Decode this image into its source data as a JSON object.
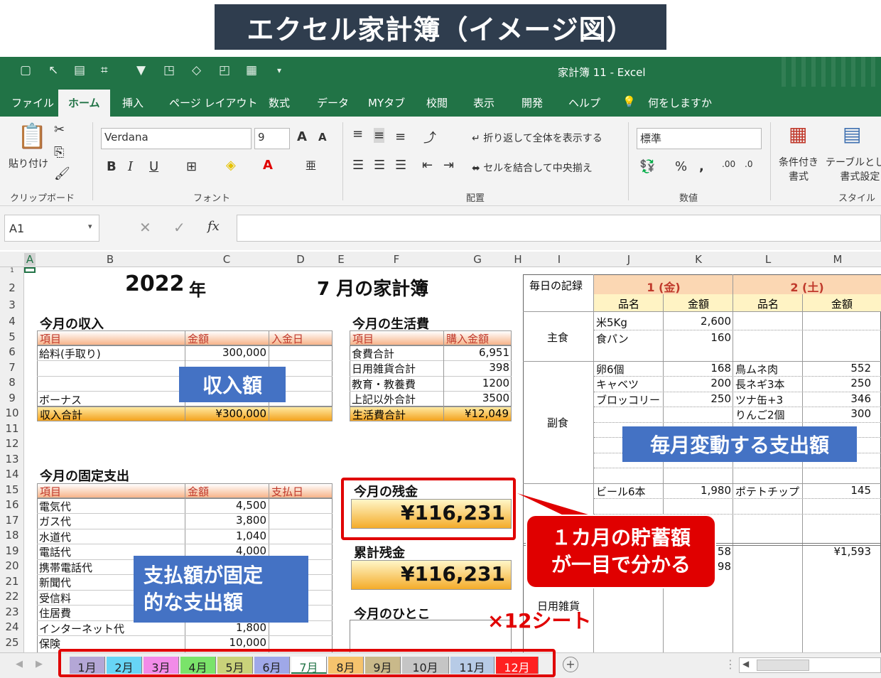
{
  "banner": {
    "title": "エクセル家計簿（イメージ図）"
  },
  "window": {
    "title": "家計簿 11  -  Excel"
  },
  "ribbon_tabs": [
    "ファイル",
    "ホーム",
    "挿入",
    "ページ レイアウト",
    "数式",
    "データ",
    "MYタブ",
    "校閲",
    "表示",
    "開発",
    "ヘルプ"
  ],
  "tell_me": "何をしますか",
  "ribbon": {
    "paste": "貼り付け",
    "clipboard_group": "クリップボード",
    "font_name": "Verdana",
    "font_size": "9",
    "font_group": "フォント",
    "wrap_text": "折り返して全体を表示する",
    "merge_center": "セルを結合して中央揃え",
    "align_group": "配置",
    "number_format": "標準",
    "number_group": "数値",
    "cond_format": "条件付き\n書式",
    "table_format": "テーブルとして\n書式設定",
    "style_group": "スタイル"
  },
  "namebox": "A1",
  "fx": "fx",
  "columns": [
    "A",
    "B",
    "C",
    "D",
    "E",
    "F",
    "G",
    "H",
    "I",
    "J",
    "K",
    "L",
    "M"
  ],
  "rows": [
    "1",
    "2",
    "3",
    "4",
    "5",
    "6",
    "7",
    "8",
    "9",
    "10",
    "11",
    "12",
    "13",
    "14",
    "15",
    "16",
    "17",
    "18",
    "19",
    "20",
    "21",
    "22",
    "23",
    "24",
    "25"
  ],
  "sheet": {
    "year": "2022",
    "year_unit": "年",
    "month_title": "7 月の家計簿",
    "income": {
      "title": "今月の収入",
      "headers": [
        "項目",
        "金額",
        "入金日"
      ],
      "rows": [
        [
          "給料(手取り)",
          "300,000"
        ],
        [
          "",
          ""
        ],
        [
          "",
          ""
        ],
        [
          "ボーナス",
          ""
        ]
      ],
      "total_label": "収入合計",
      "total": "¥300,000"
    },
    "living": {
      "title": "今月の生活費",
      "headers": [
        "項目",
        "購入金額"
      ],
      "rows": [
        [
          "食費合計",
          "6,951"
        ],
        [
          "日用雑貨合計",
          "398"
        ],
        [
          "教育・教養費",
          "1200"
        ],
        [
          "上記以外合計",
          "3500"
        ]
      ],
      "total_label": "生活費合計",
      "total": "¥12,049"
    },
    "fixed": {
      "title": "今月の固定支出",
      "headers": [
        "項目",
        "金額",
        "支払日"
      ],
      "rows": [
        [
          "電気代",
          "4,500"
        ],
        [
          "ガス代",
          "3,800"
        ],
        [
          "水道代",
          "1,040"
        ],
        [
          "電話代",
          "4,000"
        ],
        [
          "携帯電話代",
          ""
        ],
        [
          "新聞代",
          ""
        ],
        [
          "受信料",
          ""
        ],
        [
          "住居費",
          ""
        ],
        [
          "インターネット代",
          "1,800"
        ],
        [
          "保険",
          "10,000"
        ]
      ]
    },
    "balance": {
      "title": "今月の残金",
      "value": "¥116,231"
    },
    "cumulative": {
      "title": "累計残金",
      "value": "¥116,231"
    },
    "memo_title": "今月のひとこ",
    "daily": {
      "title": "毎日の記録",
      "day1": "1 (金)",
      "day2": "2 (土)",
      "item_h": "品名",
      "amount_h": "金額",
      "cat_main": "主食",
      "cat_side": "副食",
      "cat_daily": "日用雑貨",
      "day1_items": [
        [
          "米5Kg",
          "2,600"
        ],
        [
          "食パン",
          "160"
        ],
        [
          "卵6個",
          "168"
        ],
        [
          "キャベツ",
          "200"
        ],
        [
          "ブロッコリー",
          "250"
        ],
        [
          "ビール6本",
          "1,980"
        ]
      ],
      "day2_items": [
        [
          "鳥ムネ肉",
          "552"
        ],
        [
          "長ネギ3本",
          "250"
        ],
        [
          "ツナ缶+3",
          "346"
        ],
        [
          "りんご2個",
          "300"
        ],
        [
          "ポテトチップ",
          "145"
        ]
      ],
      "day1_total_partial": "58",
      "day1_total_partial2": "98",
      "day2_total": "¥1,593"
    }
  },
  "annotations": {
    "income": "収入額",
    "variable": "毎月変動する支出額",
    "fixed": "支払額が固定\n的な支出額",
    "savings": "１カ月の貯蓄額\nが一目で分かる",
    "times12": "×12シート"
  },
  "sheet_tabs": [
    {
      "label": "1月",
      "color": "#b4a7d6"
    },
    {
      "label": "2月",
      "color": "#67d5f5"
    },
    {
      "label": "3月",
      "color": "#f28be8"
    },
    {
      "label": "4月",
      "color": "#7ae36a"
    },
    {
      "label": "5月",
      "color": "#c9d27a"
    },
    {
      "label": "6月",
      "color": "#9fa8e8"
    },
    {
      "label": "7月",
      "color": "#ffffff"
    },
    {
      "label": "8月",
      "color": "#f6c36d"
    },
    {
      "label": "9月",
      "color": "#c9b98a"
    },
    {
      "label": "10月",
      "color": "#c5c5c5"
    },
    {
      "label": "11月",
      "color": "#b7cbe6"
    },
    {
      "label": "12月",
      "color": "#ff2020"
    }
  ]
}
